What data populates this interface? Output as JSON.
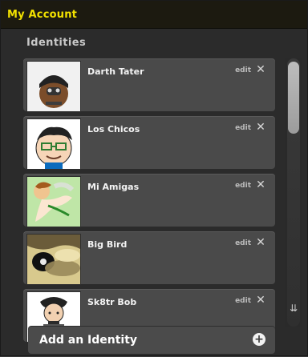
{
  "header": {
    "title": "My Account"
  },
  "identities": {
    "section_title": "Identities",
    "items": [
      {
        "name": "Darth Tater",
        "edit": "edit"
      },
      {
        "name": "Los Chicos",
        "edit": "edit"
      },
      {
        "name": "Mi Amigas",
        "edit": "edit"
      },
      {
        "name": "Big Bird",
        "edit": "edit"
      },
      {
        "name": "Sk8tr Bob",
        "edit": "edit"
      }
    ],
    "add_label": "Add an Identity"
  },
  "icons": {
    "close": "close-icon",
    "add": "plus-circle-icon",
    "scroll_down": "double-chevron-down-icon"
  }
}
